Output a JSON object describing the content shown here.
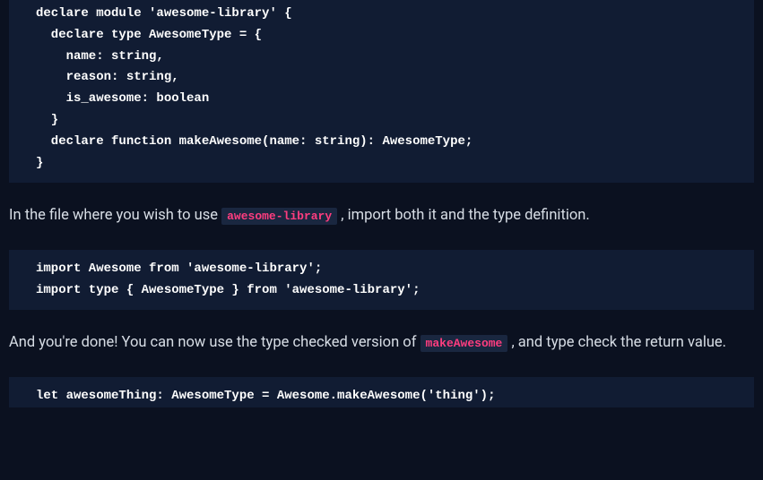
{
  "blocks": {
    "code1": "declare module 'awesome-library' {\n  declare type AwesomeType = {\n    name: string,\n    reason: string,\n    is_awesome: boolean\n  }\n  declare function makeAwesome(name: string): AwesomeType;\n}",
    "para1_a": "In the file where you wish to use ",
    "para1_code": "awesome-library",
    "para1_b": " , import both it and the type definition.",
    "code2": "import Awesome from 'awesome-library';\nimport type { AwesomeType } from 'awesome-library';",
    "para2_a": "And you're done! You can now use the type checked version of ",
    "para2_code": "makeAwesome",
    "para2_b": " , and type check the return value.",
    "code3": "let awesomeThing: AwesomeType = Awesome.makeAwesome('thing');"
  }
}
